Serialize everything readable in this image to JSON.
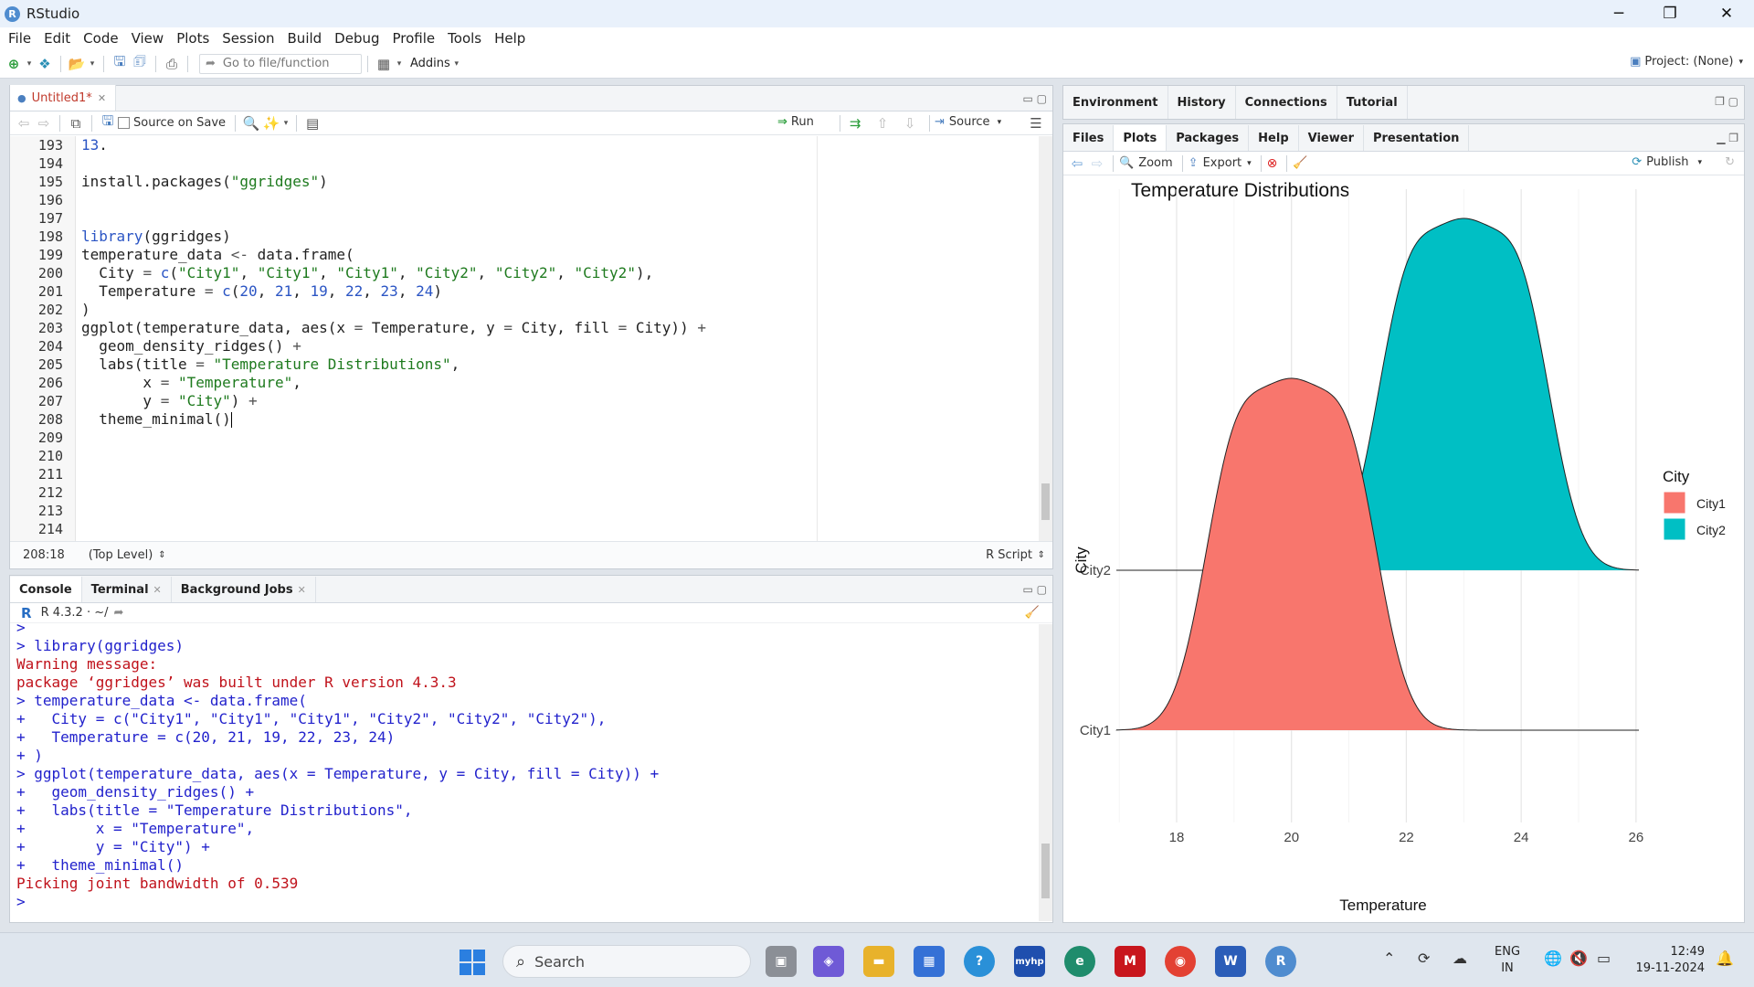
{
  "window": {
    "title": "RStudio",
    "minimize": "─",
    "maximize": "❐",
    "close": "✕"
  },
  "menu": [
    "File",
    "Edit",
    "Code",
    "View",
    "Plots",
    "Session",
    "Build",
    "Debug",
    "Profile",
    "Tools",
    "Help"
  ],
  "toolbar": {
    "goto_placeholder": "Go to file/function",
    "addins": "Addins",
    "project": "Project: (None)"
  },
  "editor": {
    "tab_label": "Untitled1*",
    "source_on_save": "Source on Save",
    "run": "Run",
    "source": "Source",
    "status_pos": "208:18",
    "status_scope": "(Top Level)",
    "status_type": "R Script",
    "lines": [
      {
        "n": "193",
        "t": "13."
      },
      {
        "n": "194",
        "t": ""
      },
      {
        "n": "195",
        "t": "install.packages(\"ggridges\")"
      },
      {
        "n": "196",
        "t": ""
      },
      {
        "n": "197",
        "t": ""
      },
      {
        "n": "198",
        "t": "library(ggridges)"
      },
      {
        "n": "199",
        "t": "temperature_data <- data.frame("
      },
      {
        "n": "200",
        "t": "  City = c(\"City1\", \"City1\", \"City1\", \"City2\", \"City2\", \"City2\"),"
      },
      {
        "n": "201",
        "t": "  Temperature = c(20, 21, 19, 22, 23, 24)"
      },
      {
        "n": "202",
        "t": ")"
      },
      {
        "n": "203",
        "t": "ggplot(temperature_data, aes(x = Temperature, y = City, fill = City)) +"
      },
      {
        "n": "204",
        "t": "  geom_density_ridges() +"
      },
      {
        "n": "205",
        "t": "  labs(title = \"Temperature Distributions\","
      },
      {
        "n": "206",
        "t": "       x = \"Temperature\","
      },
      {
        "n": "207",
        "t": "       y = \"City\") +"
      },
      {
        "n": "208",
        "t": "  theme_minimal()"
      },
      {
        "n": "209",
        "t": ""
      },
      {
        "n": "210",
        "t": ""
      },
      {
        "n": "211",
        "t": ""
      },
      {
        "n": "212",
        "t": ""
      },
      {
        "n": "213",
        "t": ""
      },
      {
        "n": "214",
        "t": ""
      }
    ]
  },
  "console": {
    "tabs": [
      "Console",
      "Terminal",
      "Background Jobs"
    ],
    "r_version": "R 4.3.2 · ~/",
    "lines": [
      {
        "k": "in",
        "t": ">"
      },
      {
        "k": "in",
        "t": "> library(ggridges)"
      },
      {
        "k": "err",
        "t": "Warning message:"
      },
      {
        "k": "err",
        "t": "package ‘ggridges’ was built under R version 4.3.3"
      },
      {
        "k": "in",
        "t": "> temperature_data <- data.frame("
      },
      {
        "k": "in",
        "t": "+   City = c(\"City1\", \"City1\", \"City1\", \"City2\", \"City2\", \"City2\"),"
      },
      {
        "k": "in",
        "t": "+   Temperature = c(20, 21, 19, 22, 23, 24)"
      },
      {
        "k": "in",
        "t": "+ )"
      },
      {
        "k": "in",
        "t": "> ggplot(temperature_data, aes(x = Temperature, y = City, fill = City)) +"
      },
      {
        "k": "in",
        "t": "+   geom_density_ridges() +"
      },
      {
        "k": "in",
        "t": "+   labs(title = \"Temperature Distributions\","
      },
      {
        "k": "in",
        "t": "+        x = \"Temperature\","
      },
      {
        "k": "in",
        "t": "+        y = \"City\") +"
      },
      {
        "k": "in",
        "t": "+   theme_minimal()"
      },
      {
        "k": "err",
        "t": "Picking joint bandwidth of 0.539"
      },
      {
        "k": "in",
        "t": "> "
      }
    ]
  },
  "env_tabs": [
    "Environment",
    "History",
    "Connections",
    "Tutorial"
  ],
  "files_tabs": [
    "Files",
    "Plots",
    "Packages",
    "Help",
    "Viewer",
    "Presentation"
  ],
  "plots_toolbar": {
    "zoom": "Zoom",
    "export": "Export",
    "publish": "Publish"
  },
  "chart_data": {
    "type": "ridgeline",
    "title": "Temperature Distributions",
    "xlabel": "Temperature",
    "ylabel": "City",
    "xlim": [
      16.95,
      26.05
    ],
    "xticks": [
      "18",
      "20",
      "22",
      "24",
      "26"
    ],
    "categories": [
      "City1",
      "City2"
    ],
    "legend": {
      "title": "City",
      "placement": "right"
    },
    "colors": {
      "City1": "#f8766d",
      "City2": "#00bfc4"
    },
    "bandwidth": 0.539,
    "series": [
      {
        "name": "City1",
        "values": [
          20,
          21,
          19
        ]
      },
      {
        "name": "City2",
        "values": [
          22,
          23,
          24
        ]
      }
    ]
  },
  "taskbar": {
    "search": "Search",
    "lang1": "ENG",
    "lang2": "IN",
    "time": "12:49",
    "date": "19-11-2024"
  }
}
